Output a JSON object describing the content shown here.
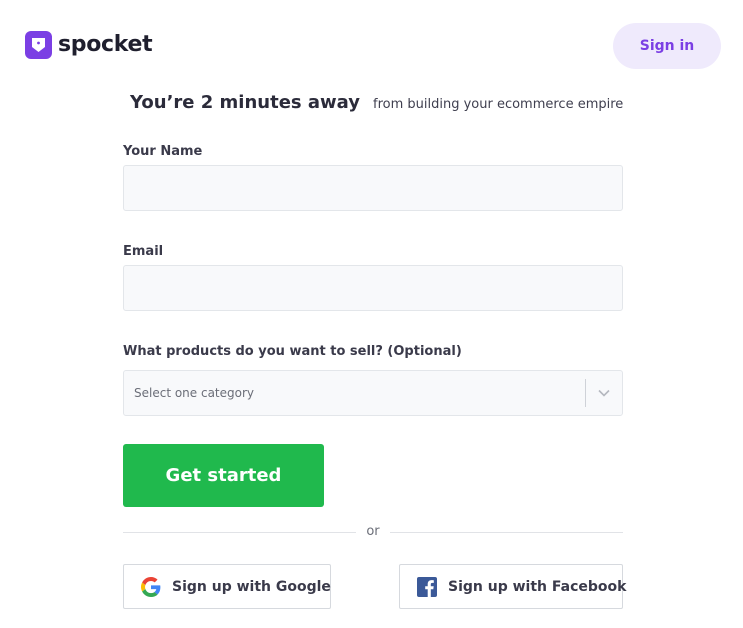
{
  "header": {
    "logo_text": "spocket",
    "signin_label": "Sign in"
  },
  "headline": {
    "main": "You’re 2 minutes away",
    "sub": "from building your ecommerce empire"
  },
  "form": {
    "name": {
      "label": "Your Name",
      "value": "",
      "placeholder": ""
    },
    "email": {
      "label": "Email",
      "value": "",
      "placeholder": ""
    },
    "products": {
      "label": "What products do you want to sell? (Optional)",
      "selected": "Select one category"
    },
    "submit_label": "Get started"
  },
  "divider_text": "or",
  "social": {
    "google_label": "Sign up with Google",
    "facebook_label": "Sign up with Facebook"
  },
  "colors": {
    "brand_purple": "#7b3fe4",
    "signin_bg": "#efeafc",
    "cta_green": "#20b94d",
    "facebook_blue": "#3b5998"
  },
  "icons": [
    "spocket-logo-icon",
    "chevron-down-icon",
    "google-icon",
    "facebook-icon"
  ]
}
